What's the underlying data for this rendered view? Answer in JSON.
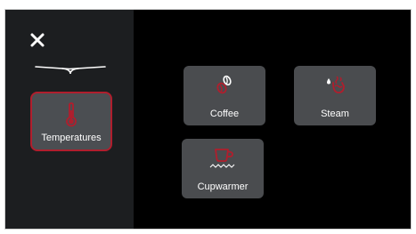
{
  "colors": {
    "accent": "#b01e2d",
    "sidebar_bg": "#1c1e20",
    "tile_bg": "#4a4c4f",
    "selected_bg": "#4b4e52"
  },
  "sidebar": {
    "close_icon": "close-icon",
    "brand_icon": "brand-swoosh-icon",
    "items": [
      {
        "label": "Temperatures",
        "icon": "thermometer-icon",
        "selected": true
      }
    ]
  },
  "main": {
    "tiles": [
      {
        "label": "Coffee",
        "icon": "coffee-bean-icon"
      },
      {
        "label": "Steam",
        "icon": "steam-icon"
      },
      {
        "label": "Cupwarmer",
        "icon": "cupwarmer-icon"
      }
    ]
  }
}
